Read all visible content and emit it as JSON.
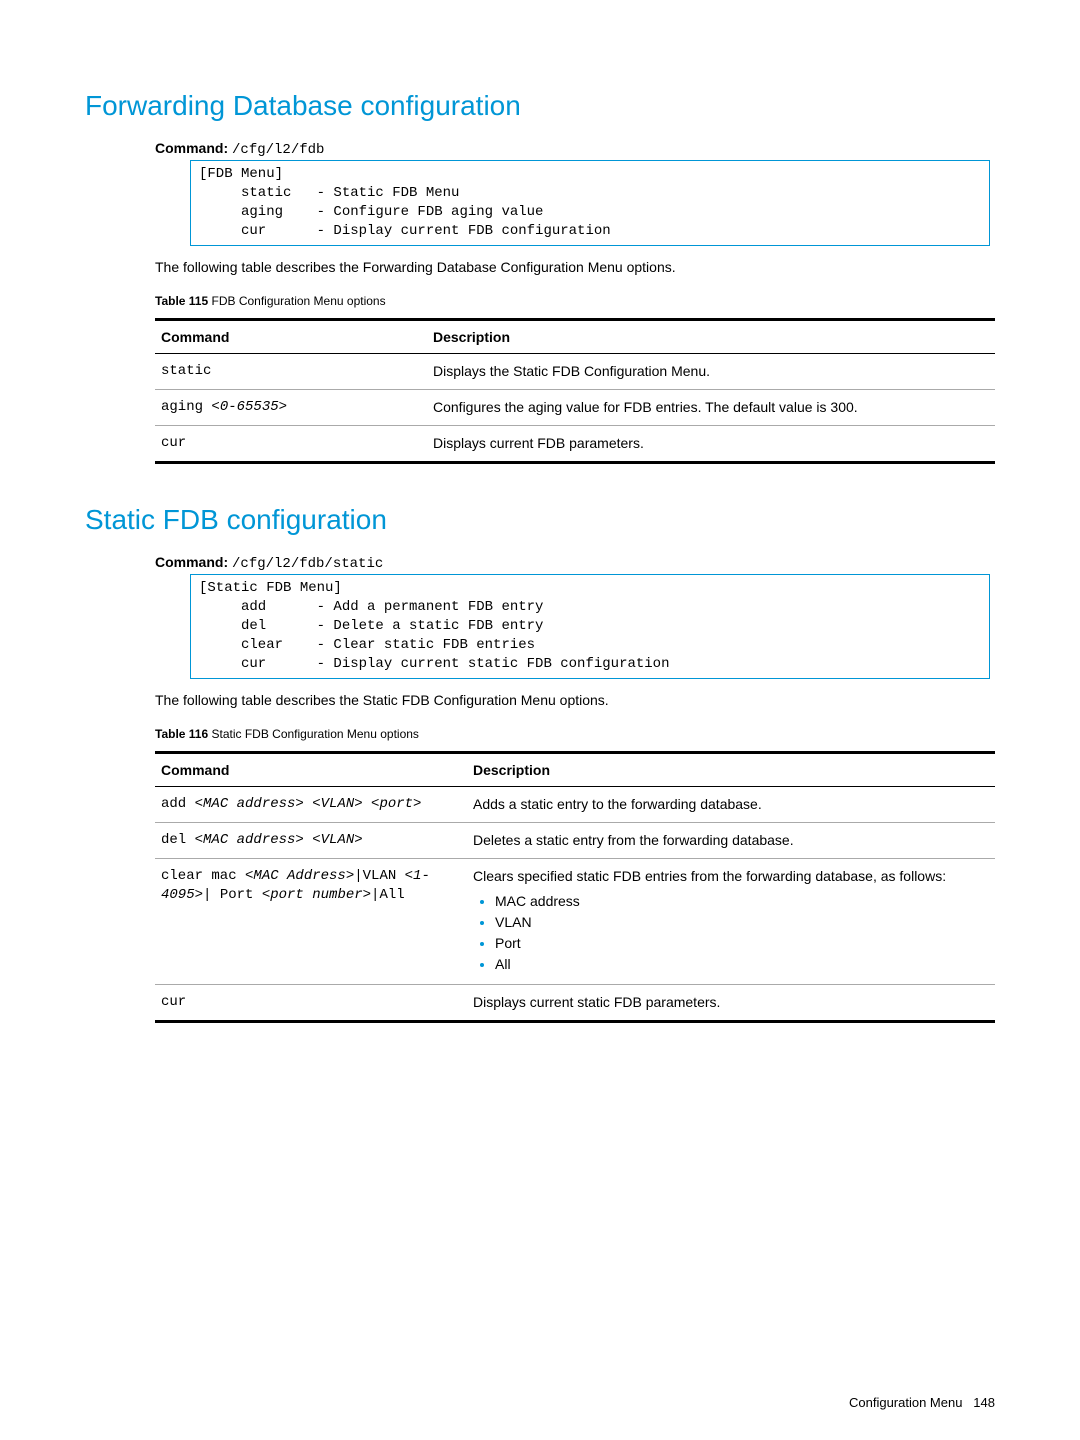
{
  "section1": {
    "title": "Forwarding Database configuration",
    "cmd_label": "Command:",
    "cmd_path": " /cfg/l2/fdb",
    "menu_text": "[FDB Menu]\n     static   - Static FDB Menu\n     aging    - Configure FDB aging value\n     cur      - Display current FDB configuration",
    "intro": "The following table describes the Forwarding Database Configuration Menu options.",
    "table_caption_bold": "Table 115",
    "table_caption_rest": "  FDB Configuration Menu options",
    "col1": "Command",
    "col2": "Description",
    "rows": [
      {
        "cmd": "static",
        "desc": "Displays the Static FDB Configuration Menu."
      },
      {
        "cmd_html": "aging <i>&lt;0-65535&gt;</i>",
        "desc": "Configures the aging value for FDB entries. The default value is 300."
      },
      {
        "cmd": "cur",
        "desc": "Displays current FDB parameters."
      }
    ]
  },
  "section2": {
    "title": "Static FDB configuration",
    "cmd_label": "Command:",
    "cmd_path": " /cfg/l2/fdb/static",
    "menu_text": "[Static FDB Menu]\n     add      - Add a permanent FDB entry\n     del      - Delete a static FDB entry\n     clear    - Clear static FDB entries\n     cur      - Display current static FDB configuration",
    "intro": "The following table describes the Static FDB Configuration Menu options.",
    "table_caption_bold": "Table 116",
    "table_caption_rest": "  Static FDB Configuration Menu options",
    "col1": "Command",
    "col2": "Description",
    "rows": [
      {
        "cmd_html": "add <i>&lt;MAC address&gt; &lt;VLAN&gt; &lt;port&gt;</i>",
        "desc": "Adds a static entry to the forwarding database."
      },
      {
        "cmd_html": "del <i>&lt;MAC address&gt; &lt;VLAN&gt;</i>",
        "desc": "Deletes a static entry from the forwarding database."
      },
      {
        "cmd_html": "clear mac <i>&lt;MAC Address&gt;</i>|VLAN <i>&lt;1-4095&gt;</i>| Port <i>&lt;port number&gt;</i>|All",
        "desc_lead": "Clears specified static FDB entries from the forwarding database, as follows:",
        "bullets": [
          "MAC address",
          "VLAN",
          "Port",
          "All"
        ]
      },
      {
        "cmd": "cur",
        "desc": "Displays current static FDB parameters."
      }
    ]
  },
  "footer": {
    "label": "Configuration Menu",
    "page": "148"
  }
}
